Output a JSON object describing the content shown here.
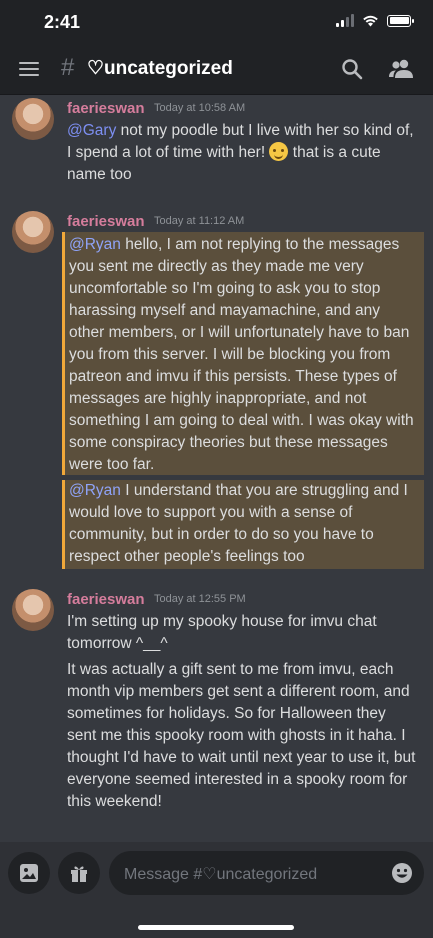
{
  "status": {
    "time": "2:41"
  },
  "header": {
    "hash": "#",
    "channel": "♡uncategorized"
  },
  "messages": [
    {
      "author": "faerieswan",
      "timestamp": "Today at 10:58 AM",
      "mention": "@Gary",
      "text_a": " not my poodle but I live with her so kind of, I spend a lot of time with her! ",
      "text_b": " that is a cute name too"
    },
    {
      "author": "faerieswan",
      "timestamp": "Today at 11:12 AM",
      "block1_mention": "@Ryan",
      "block1_text": " hello, I am not replying to the messages you sent me directly as they made me very uncomfortable so I'm going to ask you to stop harassing myself and mayamachine, and any other members, or I will unfortunately have to ban you from this server.  I will be blocking you from patreon and imvu if this persists.  These types of messages are highly inappropriate, and not something I am going to deal with.  I was okay with some conspiracy theories but these messages were too far.",
      "block2_mention": "@Ryan",
      "block2_text": " I understand that you are struggling and I would love to support you with a sense of community, but in order to do so you have to respect other people's feelings too"
    },
    {
      "author": "faerieswan",
      "timestamp": "Today at 12:55 PM",
      "line1": "I'm setting up my spooky house for imvu chat tomorrow ^__^",
      "line2": "It was actually a gift sent to me from imvu, each month vip members get sent a different room, and sometimes for holidays. So for Halloween they sent me this spooky room with ghosts in it haha. I thought I'd have to wait until next year to use it, but everyone seemed interested in a spooky room for this weekend!"
    }
  ],
  "composer": {
    "placeholder": "Message #♡uncategorized"
  },
  "icons": [
    "menu-icon",
    "search-icon",
    "members-icon",
    "image-icon",
    "gift-icon",
    "emoji-icon",
    "hugging-face-emoji"
  ],
  "colors": {
    "accent_username": "#d57d9c",
    "mention": "#7d8ff2",
    "highlight_bg": "#5b4f3c",
    "highlight_border": "#f0a83a"
  }
}
